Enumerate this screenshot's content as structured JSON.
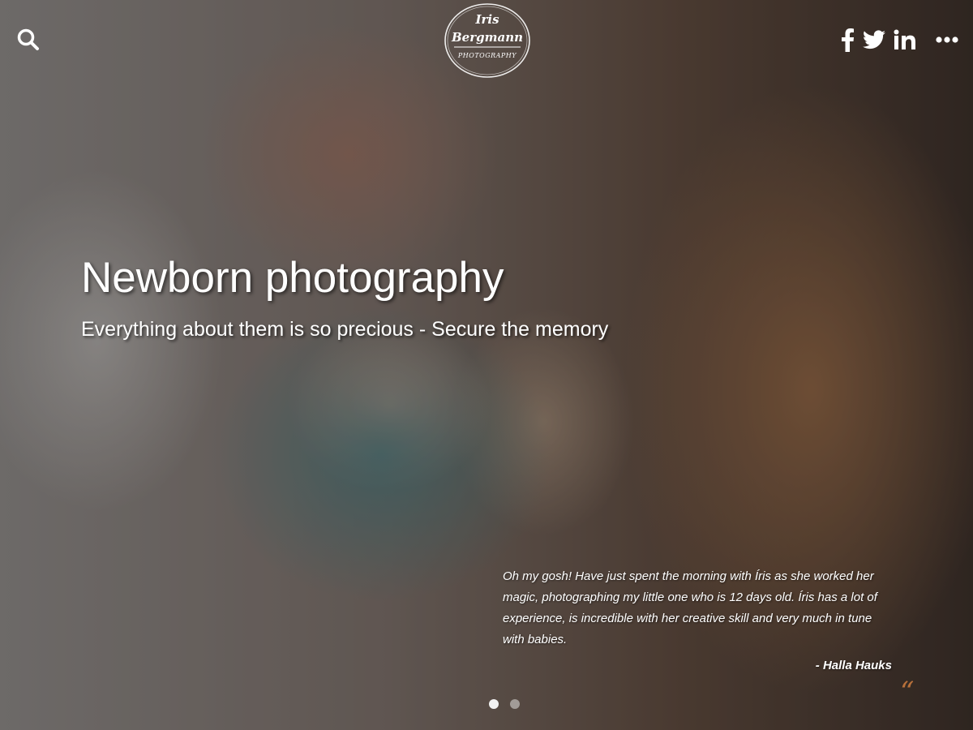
{
  "header": {
    "search_icon": "search-icon",
    "logo": {
      "line1": "Iris",
      "line2": "Bergmann",
      "line3": "PHOTOGRAPHY"
    },
    "social": [
      {
        "icon": "facebook-icon"
      },
      {
        "icon": "twitter-icon"
      },
      {
        "icon": "linkedin-icon"
      },
      {
        "icon": "more-icon"
      }
    ]
  },
  "hero": {
    "title": "Newborn photography",
    "subtitle": "Everything about them is so precious - Secure the memory"
  },
  "testimonial": {
    "quote": "Oh my gosh! Have just spent the morning with Íris as she worked her magic, photographing my little one who is 12 days old. Íris has a lot of experience, is incredible with her creative skill and very much in tune with babies.",
    "author": "- Halla Hauks",
    "quote_mark": "“"
  },
  "slider": {
    "count": 2,
    "active": 1
  },
  "colors": {
    "text": "#ffffff",
    "quote_mark": "#b8703a"
  }
}
